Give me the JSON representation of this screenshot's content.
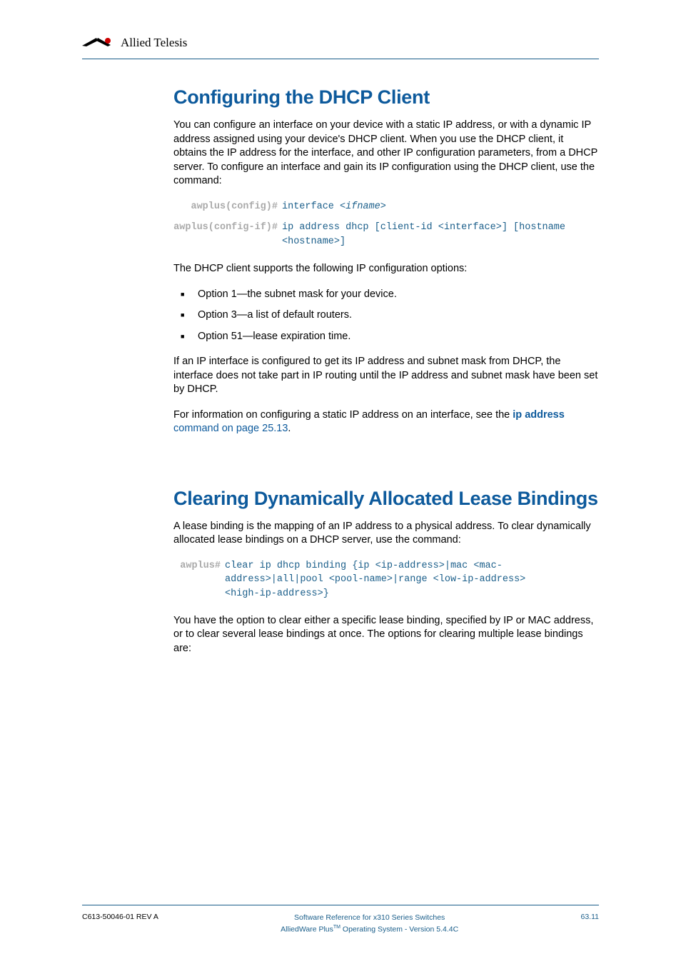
{
  "header": {
    "company": "Allied Telesis"
  },
  "section1": {
    "heading": "Configuring the DHCP Client",
    "intro": "You can configure an interface on your device with a static IP address, or with a dynamic IP address assigned using your device's DHCP client. When you use the DHCP client, it obtains the IP address for the interface, and other IP configuration parameters, from a DHCP server. To configure an interface and gain its IP configuration using the DHCP client, use the command:",
    "cmds": [
      {
        "prompt": "awplus(config)#",
        "command_pre": "interface ",
        "command_italic": "<ifname>",
        "command_post": ""
      },
      {
        "prompt": "awplus(config-if)#",
        "command_pre": "ip address dhcp [client-id <interface>] [hostname <hostname>]",
        "command_italic": "",
        "command_post": ""
      }
    ],
    "options_intro": "The DHCP client supports the following IP configuration options:",
    "options": [
      "Option 1—the subnet mask for your device.",
      "Option 3—a list of default routers.",
      "Option 51—lease expiration time."
    ],
    "routing_note": "If an IP interface is configured to get its IP address and subnet mask from DHCP, the interface does not take part in IP routing until the IP address and subnet mask have been set by DHCP.",
    "ref_pre": "For information on configuring a static IP address on an interface, see the ",
    "ref_link_bold": "ip address",
    "ref_link_rest": " command on page 25.13",
    "ref_post": "."
  },
  "section2": {
    "heading": "Clearing Dynamically Allocated Lease Bindings",
    "intro": "A lease binding is the mapping of an IP address to a physical address. To clear dynamically allocated lease bindings on a DHCP server, use the command:",
    "cmds": [
      {
        "prompt": "awplus#",
        "command_pre": "clear ip dhcp binding {ip <ip-address>|mac <mac-address>|all|pool <pool-name>|range <low-ip-address> <high-ip-address>}",
        "command_italic": "",
        "command_post": ""
      }
    ],
    "post": "You have the option to clear either a specific lease binding, specified by IP or MAC address, or to clear several lease bindings at once. The options for clearing multiple lease bindings are:"
  },
  "footer": {
    "left": "C613-50046-01 REV A",
    "center1": "Software Reference for x310 Series Switches",
    "center2_pre": "AlliedWare Plus",
    "center2_tm": "TM",
    "center2_post": " Operating System - Version 5.4.4C",
    "right": "63.11"
  }
}
